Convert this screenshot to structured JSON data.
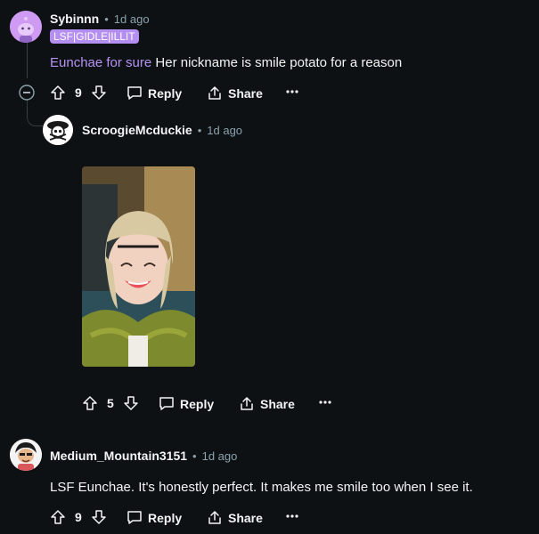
{
  "comments": [
    {
      "username": "Sybinnn",
      "time": "1d ago",
      "flair": "LSF|GIDLE|ILLIT",
      "highlight": "Eunchae for sure",
      "text": "Her nickname is smile potato for a reason",
      "votes": "9",
      "reply_label": "Reply",
      "share_label": "Share",
      "avatar_icon": "snoo-avatar-icon"
    },
    {
      "username": "ScroogieMcduckie",
      "time": "1d ago",
      "votes": "5",
      "reply_label": "Reply",
      "share_label": "Share",
      "image_icon": "photo-of-smiling-person"
    },
    {
      "username": "Medium_Mountain3151",
      "time": "1d ago",
      "text": "LSF Eunchae. It's honestly perfect. It makes me smile too when I see it.",
      "votes": "9",
      "reply_label": "Reply",
      "share_label": "Share"
    }
  ],
  "colors": {
    "background": "#0e1113",
    "flair": "#b48ef0",
    "highlight": "#b592f5",
    "meta": "#8ba2ad"
  },
  "dot_separator": "•"
}
